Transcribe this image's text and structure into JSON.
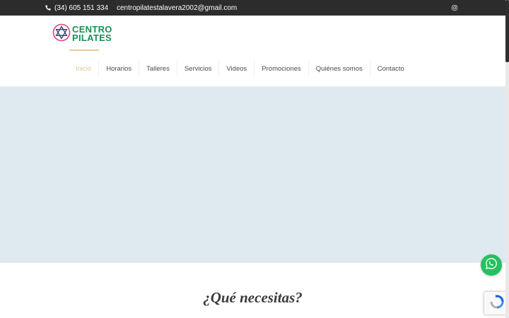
{
  "topbar": {
    "phone": "(34) 605 151 334",
    "email": "centropilatestalavera2002@gmail.com",
    "phone_icon": "phone-icon",
    "email_icon": "mail-icon",
    "social_icon": "instagram-icon"
  },
  "logo": {
    "line1": "CENTRO",
    "line2": "PILATES"
  },
  "nav": {
    "items": [
      {
        "label": "Inicio",
        "active": true
      },
      {
        "label": "Horarios"
      },
      {
        "label": "Talleres"
      },
      {
        "label": "Servicios"
      },
      {
        "label": "Videos"
      },
      {
        "label": "Promociones"
      },
      {
        "label": "Quiénes somos"
      },
      {
        "label": "Contacto"
      }
    ]
  },
  "section": {
    "title": "¿Qué necesitas?"
  },
  "colors": {
    "topbar_bg": "#2c2c2c",
    "brand_green": "#1a8e55",
    "brand_pink": "#e0457b",
    "nav_active": "#e4c49a",
    "hero_bg": "#dfeaf0",
    "whatsapp": "#25c060"
  },
  "widgets": {
    "whatsapp_icon": "whatsapp-icon",
    "recaptcha_icon": "recaptcha-icon"
  }
}
